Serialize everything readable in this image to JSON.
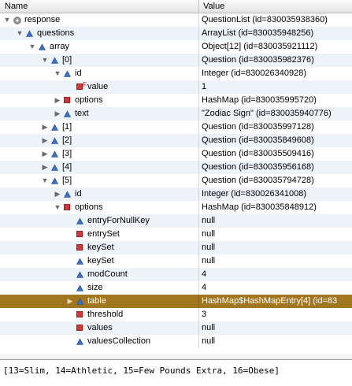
{
  "header": {
    "name_label": "Name",
    "value_label": "Value"
  },
  "tree": [
    {
      "depth": 0,
      "expand": "open",
      "icon": "gear-icon",
      "name": "response",
      "value": "QuestionList  (id=830035938360)"
    },
    {
      "depth": 1,
      "expand": "open",
      "icon": "triangle-icon",
      "name": "questions",
      "value": "ArrayList  (id=830035948256)"
    },
    {
      "depth": 2,
      "expand": "open",
      "icon": "triangle-icon",
      "name": "array",
      "value": "Object[12]  (id=830035921112)"
    },
    {
      "depth": 3,
      "expand": "open",
      "icon": "triangle-icon",
      "name": "[0]",
      "value": "Question  (id=830035982376)"
    },
    {
      "depth": 4,
      "expand": "open",
      "icon": "triangle-icon",
      "name": "id",
      "value": "Integer  (id=830026340928)"
    },
    {
      "depth": 5,
      "expand": "none",
      "icon": "square-icon",
      "final": "F",
      "name": "value",
      "value": "1"
    },
    {
      "depth": 4,
      "expand": "closed",
      "icon": "square-icon",
      "name": "options",
      "value": "HashMap  (id=830035995720)"
    },
    {
      "depth": 4,
      "expand": "closed",
      "icon": "triangle-icon",
      "name": "text",
      "value": "\"Zodiac Sign\" (id=830035940776)"
    },
    {
      "depth": 3,
      "expand": "closed",
      "icon": "triangle-icon",
      "name": "[1]",
      "value": "Question  (id=830035997128)"
    },
    {
      "depth": 3,
      "expand": "closed",
      "icon": "triangle-icon",
      "name": "[2]",
      "value": "Question  (id=830035849608)"
    },
    {
      "depth": 3,
      "expand": "closed",
      "icon": "triangle-icon",
      "name": "[3]",
      "value": "Question  (id=830035509416)"
    },
    {
      "depth": 3,
      "expand": "closed",
      "icon": "triangle-icon",
      "name": "[4]",
      "value": "Question  (id=830035956168)"
    },
    {
      "depth": 3,
      "expand": "open",
      "icon": "triangle-icon",
      "name": "[5]",
      "value": "Question  (id=830035794728)"
    },
    {
      "depth": 4,
      "expand": "closed",
      "icon": "triangle-icon",
      "name": "id",
      "value": "Integer  (id=830026341008)"
    },
    {
      "depth": 4,
      "expand": "open",
      "icon": "square-icon",
      "name": "options",
      "value": "HashMap  (id=830035848912)"
    },
    {
      "depth": 5,
      "expand": "none",
      "icon": "triangle-icon",
      "name": "entryForNullKey",
      "value": "null"
    },
    {
      "depth": 5,
      "expand": "none",
      "icon": "square-icon",
      "name": "entrySet",
      "value": "null"
    },
    {
      "depth": 5,
      "expand": "none",
      "icon": "square-icon",
      "name": "keySet",
      "value": "null"
    },
    {
      "depth": 5,
      "expand": "none",
      "icon": "triangle-icon",
      "name": "keySet",
      "value": "null"
    },
    {
      "depth": 5,
      "expand": "none",
      "icon": "triangle-icon",
      "name": "modCount",
      "value": "4"
    },
    {
      "depth": 5,
      "expand": "none",
      "icon": "triangle-icon",
      "name": "size",
      "value": "4"
    },
    {
      "depth": 5,
      "expand": "closed",
      "icon": "triangle-icon",
      "name": "table",
      "value": "HashMap$HashMapEntry[4]  (id=83",
      "selected": true
    },
    {
      "depth": 5,
      "expand": "none",
      "icon": "square-icon",
      "name": "threshold",
      "value": "3"
    },
    {
      "depth": 5,
      "expand": "none",
      "icon": "square-icon",
      "name": "values",
      "value": "null"
    },
    {
      "depth": 5,
      "expand": "none",
      "icon": "triangle-icon",
      "name": "valuesCollection",
      "value": "null"
    }
  ],
  "detail": {
    "text": "[13=Slim, 14=Athletic, 15=Few Pounds Extra, 16=Obese]"
  },
  "colors": {
    "selection": "#a0761e",
    "alt_row": "#eef2f9",
    "field_blue": "#3b6fc4",
    "field_red": "#d23a3a"
  }
}
